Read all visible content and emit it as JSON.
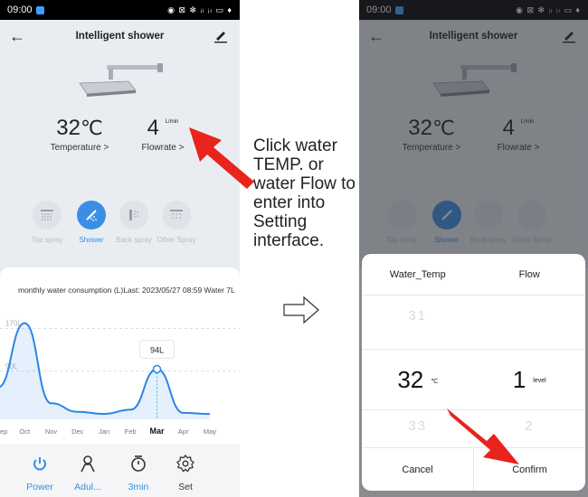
{
  "status_bar": {
    "time": "09:00",
    "indicators": "◉ ⊠ ✻ ᵢₗ ᵢₗ ▭ ♦"
  },
  "header": {
    "title": "Intelligent shower",
    "back_icon": "arrow-left-icon",
    "edit_icon": "pen-icon"
  },
  "readings": {
    "temperature": {
      "value": "32",
      "unit": "℃",
      "label": "Temperature >"
    },
    "flowrate": {
      "value": "4",
      "unit": "L/min",
      "label": "Flowrate >"
    }
  },
  "modes": [
    {
      "label": "Top spray",
      "icon": "top-spray-icon",
      "active": false
    },
    {
      "label": "Shower",
      "icon": "shower-icon",
      "active": true
    },
    {
      "label": "Back spray",
      "icon": "back-spray-icon",
      "active": false
    },
    {
      "label": "Other Spray",
      "icon": "other-spray-icon",
      "active": false
    }
  ],
  "consumption": {
    "title": "monthly water consumption (L)Last: 2023/05/27 08:59 Water 7L"
  },
  "chart_data": {
    "type": "area",
    "categories": [
      "Sep",
      "Oct",
      "Nov",
      "Dec",
      "Jan",
      "Feb",
      "Mar",
      "Apr",
      "May"
    ],
    "category_labels": [
      "ep",
      "Oct",
      "Nov",
      "Dec",
      "Jan",
      "Feb",
      "Mar",
      "Apr",
      "May"
    ],
    "values": [
      60,
      180,
      30,
      14,
      10,
      18,
      94,
      12,
      10
    ],
    "gridlines": [
      90,
      170
    ],
    "gridline_labels": [
      "90L",
      "170L"
    ],
    "highlight": {
      "category": "Mar",
      "value": 94,
      "label": "94L"
    },
    "ylim": [
      0,
      220
    ],
    "color": "#2b86e6"
  },
  "bottom_nav": [
    {
      "label": "Power",
      "icon": "power-icon"
    },
    {
      "label": "Adul...",
      "icon": "person-icon"
    },
    {
      "label": "3min",
      "icon": "timer-icon"
    },
    {
      "label": "Set",
      "icon": "gear-icon"
    }
  ],
  "instruction": "Click water TEMP. or water Flow to enter into Setting interface.",
  "picker": {
    "headers": [
      "Water_Temp",
      "Flow"
    ],
    "above": [
      "31",
      ""
    ],
    "selected": {
      "temp": "32",
      "temp_unit": "℃",
      "flow": "1",
      "flow_unit": "level"
    },
    "below": [
      "33",
      "2"
    ],
    "cancel": "Cancel",
    "confirm": "Confirm"
  },
  "colors": {
    "accent": "#3a8ee6",
    "annotation_arrow": "#e8241c",
    "page_bg": "#e9edf2"
  }
}
